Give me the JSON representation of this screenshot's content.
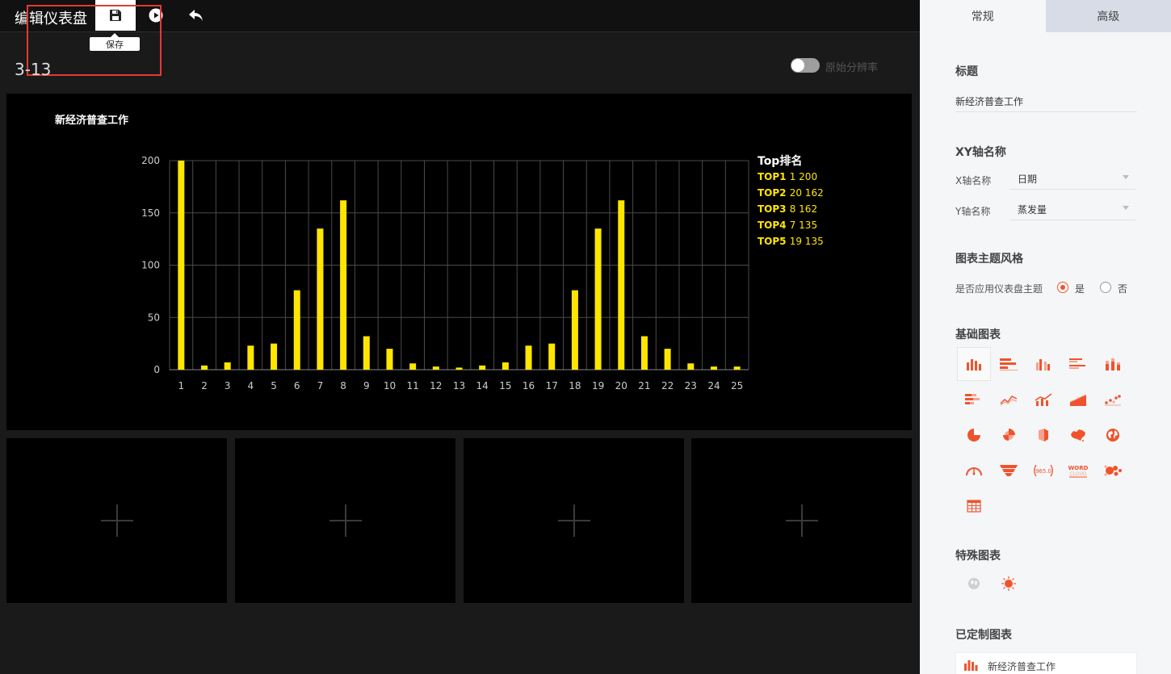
{
  "header": {
    "title": "编辑仪表盘",
    "tooltip_save": "保存"
  },
  "page": {
    "number": "3-13",
    "toggle_label": "原始分辨率"
  },
  "chart_data": {
    "type": "bar",
    "title": "新经济普查工作",
    "xlabel": "",
    "ylabel": "",
    "categories": [
      "1",
      "2",
      "3",
      "4",
      "5",
      "6",
      "7",
      "8",
      "9",
      "10",
      "11",
      "12",
      "13",
      "14",
      "15",
      "16",
      "17",
      "18",
      "19",
      "20",
      "21",
      "22",
      "23",
      "24",
      "25"
    ],
    "values": [
      200,
      4,
      7,
      23,
      25,
      76,
      135,
      162,
      32,
      20,
      6,
      3,
      2,
      4,
      7,
      23,
      25,
      76,
      135,
      162,
      32,
      20,
      6,
      3,
      3
    ],
    "ylim": [
      0,
      200
    ],
    "yticks": [
      "0",
      "50",
      "100",
      "150",
      "200"
    ],
    "grid": true,
    "bar_color": "#ffe600",
    "ranking": {
      "heading": "Top排名",
      "items": [
        {
          "rank": "TOP1",
          "detail": "1 200"
        },
        {
          "rank": "TOP2",
          "detail": "20 162"
        },
        {
          "rank": "TOP3",
          "detail": "8 162"
        },
        {
          "rank": "TOP4",
          "detail": "7 135"
        },
        {
          "rank": "TOP5",
          "detail": "19 135"
        }
      ]
    }
  },
  "right_panel": {
    "tabs": [
      "常规",
      "高级"
    ],
    "title_section": "标题",
    "title_value": "新经济普查工作",
    "axis_section": "XY轴名称",
    "x_label": "X轴名称",
    "x_value": "日期",
    "y_label": "Y轴名称",
    "y_value": "蒸发量",
    "theme_section": "图表主题风格",
    "theme_question": "是否应用仪表盘主题",
    "theme_yes": "是",
    "theme_no": "否",
    "basic_section": "基础图表",
    "gauge_text": "965.0",
    "wordcloud_text": "WORD",
    "wordcloud_text2": "CLOUD",
    "special_section": "特殊图表",
    "custom_section": "已定制图表",
    "custom_item": "新经济普查工作",
    "accent_color": "#f0532c"
  }
}
